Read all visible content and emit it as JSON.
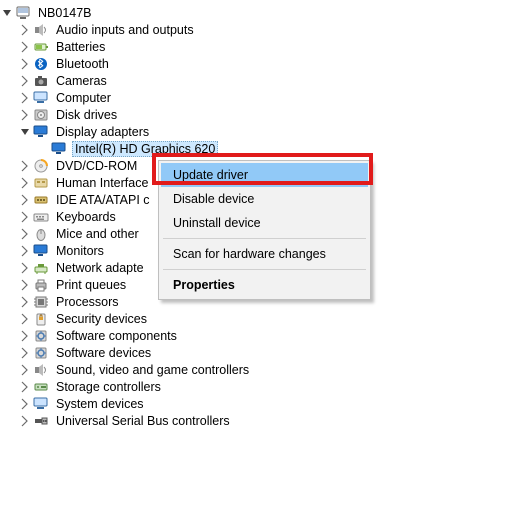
{
  "root": {
    "label": "NB0147B"
  },
  "nodes": [
    {
      "label": "Audio inputs and outputs",
      "icon": "audio"
    },
    {
      "label": "Batteries",
      "icon": "battery"
    },
    {
      "label": "Bluetooth",
      "icon": "bluetooth"
    },
    {
      "label": "Cameras",
      "icon": "camera"
    },
    {
      "label": "Computer",
      "icon": "computer"
    },
    {
      "label": "Disk drives",
      "icon": "disk"
    },
    {
      "label": "Display adapters",
      "icon": "display",
      "expanded": true,
      "children": [
        {
          "label": "Intel(R) HD Graphics 620",
          "icon": "display",
          "selected": true
        }
      ]
    },
    {
      "label": "DVD/CD-ROM drives",
      "icon": "dvd",
      "truncated": "DVD/CD-ROM "
    },
    {
      "label": "Human Interface Devices",
      "icon": "hid",
      "truncated": "Human Interface "
    },
    {
      "label": "IDE ATA/ATAPI controllers",
      "icon": "ide",
      "truncated": "IDE ATA/ATAPI c"
    },
    {
      "label": "Keyboards",
      "icon": "keyboard"
    },
    {
      "label": "Mice and other pointing devices",
      "icon": "mouse",
      "truncated": "Mice and other "
    },
    {
      "label": "Monitors",
      "icon": "monitor"
    },
    {
      "label": "Network adapters",
      "icon": "network",
      "truncated": "Network adapte"
    },
    {
      "label": "Print queues",
      "icon": "printer"
    },
    {
      "label": "Processors",
      "icon": "cpu"
    },
    {
      "label": "Security devices",
      "icon": "security"
    },
    {
      "label": "Software components",
      "icon": "softcomp"
    },
    {
      "label": "Software devices",
      "icon": "softdev"
    },
    {
      "label": "Sound, video and game controllers",
      "icon": "sound"
    },
    {
      "label": "Storage controllers",
      "icon": "storage"
    },
    {
      "label": "System devices",
      "icon": "system"
    },
    {
      "label": "Universal Serial Bus controllers",
      "icon": "usb"
    }
  ],
  "menu": {
    "items": [
      {
        "label": "Update driver",
        "highlight": true
      },
      {
        "label": "Disable device"
      },
      {
        "label": "Uninstall device"
      },
      {
        "sep": true
      },
      {
        "label": "Scan for hardware changes"
      },
      {
        "sep": true
      },
      {
        "label": "Properties",
        "bold": true
      }
    ]
  }
}
